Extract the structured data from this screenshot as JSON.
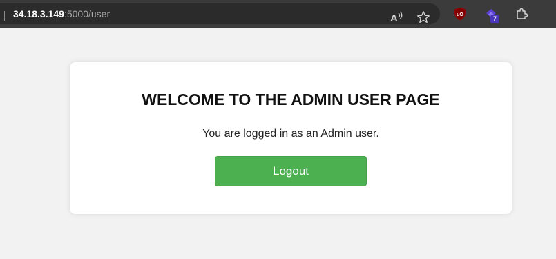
{
  "browser": {
    "url_host": "34.18.3.149",
    "url_path": ":5000/user",
    "icons": [
      "read-aloud-icon",
      "favorite-star-icon",
      "ublock-origin-icon",
      "extension-icon",
      "extensions-puzzle-icon"
    ],
    "extension_badge_count": "7"
  },
  "page": {
    "title": "WELCOME TO THE ADMIN USER PAGE",
    "message": "You are logged in as an Admin user.",
    "logout_label": "Logout"
  },
  "colors": {
    "toolbar": "#3b3b3b",
    "addressbar": "#2b2b2b",
    "page_background": "#f2f2f2",
    "card": "#ffffff",
    "button": "#4caf50",
    "ublock": "#800000",
    "extension_accent": "#5b3fd6"
  }
}
